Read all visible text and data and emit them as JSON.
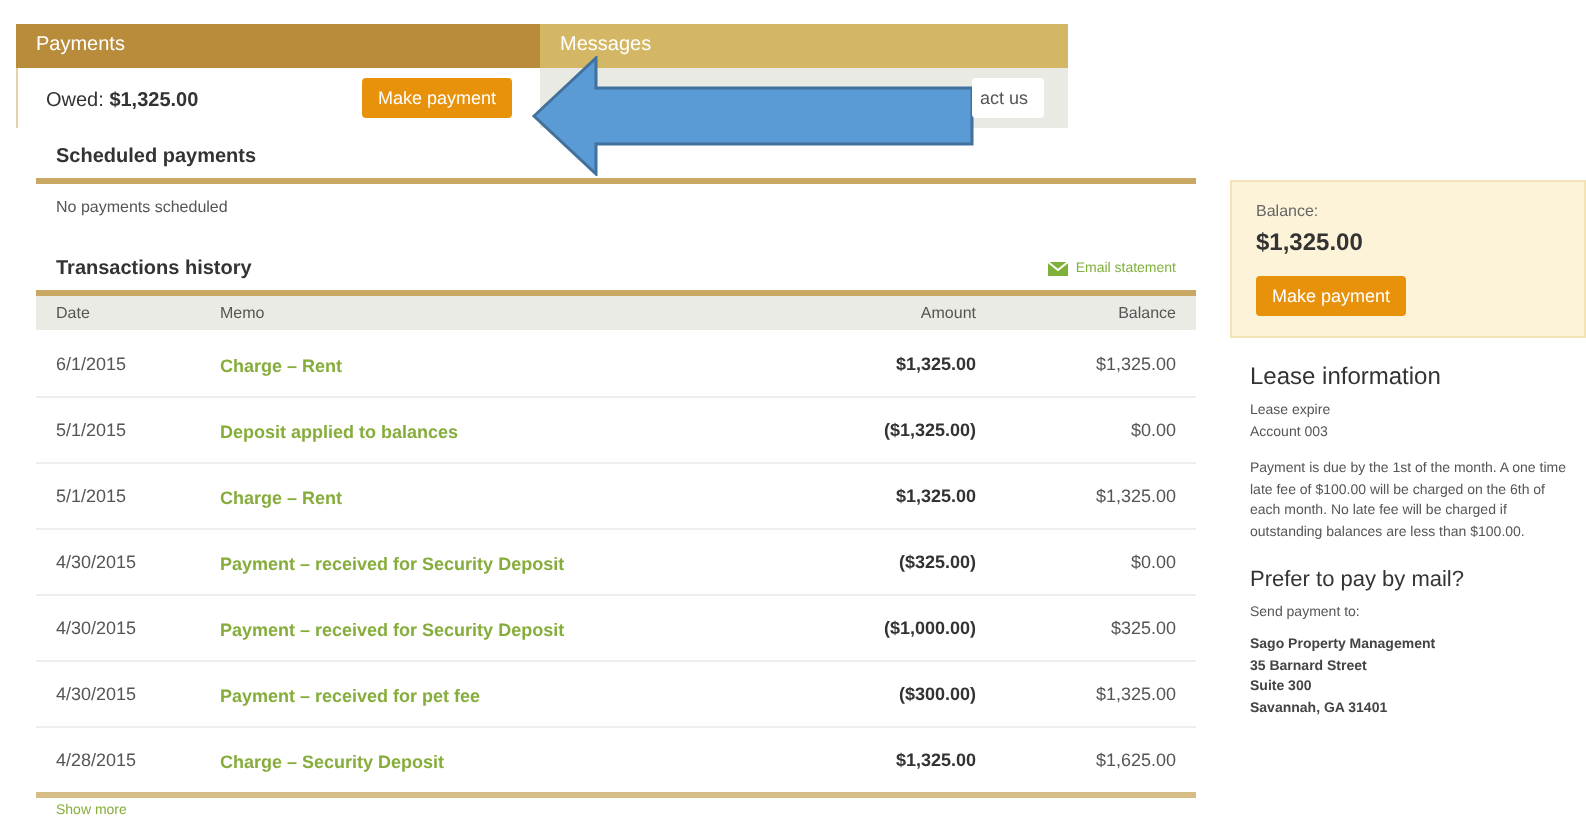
{
  "tabs": [
    {
      "label": "Payments",
      "selected": true
    },
    {
      "label": "Messages",
      "selected": false
    }
  ],
  "owed": {
    "label": "Owed:",
    "amount": "$1,325.00",
    "button": "Make payment"
  },
  "messages": {
    "button": "act us"
  },
  "scheduled": {
    "title": "Scheduled payments",
    "empty": "No payments scheduled"
  },
  "transactions": {
    "title": "Transactions history",
    "email": "Email statement",
    "columns": [
      "Date",
      "Memo",
      "Amount",
      "Balance"
    ],
    "rows": [
      {
        "date": "6/1/2015",
        "memo": "Charge – Rent",
        "amount": "$1,325.00",
        "balance": "$1,325.00"
      },
      {
        "date": "5/1/2015",
        "memo": "Deposit applied to balances",
        "amount": "($1,325.00)",
        "balance": "$0.00"
      },
      {
        "date": "5/1/2015",
        "memo": "Charge – Rent",
        "amount": "$1,325.00",
        "balance": "$1,325.00"
      },
      {
        "date": "4/30/2015",
        "memo": "Payment – received for Security Deposit",
        "amount": "($325.00)",
        "balance": "$0.00"
      },
      {
        "date": "4/30/2015",
        "memo": "Payment – received for Security Deposit",
        "amount": "($1,000.00)",
        "balance": "$325.00"
      },
      {
        "date": "4/30/2015",
        "memo": "Payment – received for pet fee",
        "amount": "($300.00)",
        "balance": "$1,325.00"
      },
      {
        "date": "4/28/2015",
        "memo": "Charge – Security Deposit",
        "amount": "$1,325.00",
        "balance": "$1,625.00"
      }
    ],
    "more": "Show more"
  },
  "balance": {
    "label": "Balance:",
    "amount": "$1,325.00",
    "button": "Make payment"
  },
  "lease": {
    "title": "Lease information",
    "lines": [
      "Lease expire",
      "Account 003"
    ],
    "note": "Payment is due by the 1st of the month. A one time late fee of $100.00 will be charged on the 6th of each month. No late fee will be charged if outstanding balances are less than $100.00."
  },
  "mail": {
    "title": "Prefer to pay by mail?",
    "intro": "Send payment to:",
    "address": [
      "Sago Property Management",
      "35 Barnard Street",
      "Suite 300",
      "Savannah, GA 31401"
    ]
  }
}
